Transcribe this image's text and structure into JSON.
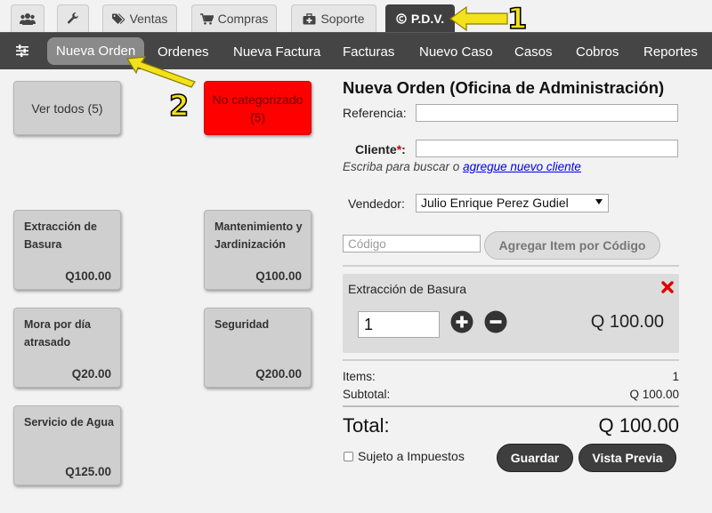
{
  "top_tabs": [
    {
      "label": "",
      "icon": "users-icon"
    },
    {
      "label": "",
      "icon": "wrench-icon"
    },
    {
      "label": "Ventas",
      "icon": "tags-icon"
    },
    {
      "label": "Compras",
      "icon": "cart-icon"
    },
    {
      "label": "Soporte",
      "icon": "medkit-icon"
    },
    {
      "label": "P.D.V.",
      "icon": "circle-c-icon",
      "active": true
    }
  ],
  "nav": {
    "items": [
      "Nueva Orden",
      "Ordenes",
      "Nueva Factura",
      "Facturas",
      "Nuevo Caso",
      "Casos",
      "Cobros",
      "Reportes"
    ],
    "active": "Nueva Orden"
  },
  "annotations": [
    "1",
    "2"
  ],
  "categories": [
    {
      "label": "Ver todos (5)",
      "color": "#cfcfcf"
    },
    {
      "label": "No categorizado (5)",
      "color": "#ff0000"
    }
  ],
  "products": [
    {
      "name": "Extracción de Basura",
      "price": "Q100.00"
    },
    {
      "name": "Mantenimiento y Jardinización",
      "price": "Q100.00"
    },
    {
      "name": "Mora por día atrasado",
      "price": "Q20.00"
    },
    {
      "name": "Seguridad",
      "price": "Q200.00"
    },
    {
      "name": "Servicio de Agua",
      "price": "Q125.00"
    }
  ],
  "order": {
    "title": "Nueva Orden (Oficina de Administración)",
    "referencia_label": "Referencia:",
    "referencia_value": "",
    "cliente_label": "Cliente",
    "cliente_value": "",
    "hint_text": "Escriba para buscar o ",
    "hint_link": "agregue nuevo cliente",
    "vendedor_label": "Vendedor:",
    "vendedor_value": "Julio Enrique Perez Gudiel",
    "codigo_placeholder": "Código",
    "add_by_code_label": "Agregar Item por Código",
    "line_item": {
      "name": "Extracción de Basura",
      "quantity": "1",
      "price": "Q 100.00"
    },
    "items_label": "Items:",
    "items_count": "1",
    "subtotal_label": "Subtotal:",
    "subtotal_value": "Q 100.00",
    "total_label": "Total:",
    "total_value": "Q 100.00",
    "tax_label": "Sujeto a Impuestos",
    "tax_checked": false,
    "save_label": "Guardar",
    "preview_label": "Vista Previa"
  },
  "colors": {
    "navbar": "#454545",
    "annotation": "#f3e21a",
    "category_red": "#ff0000",
    "delete": "#e00000"
  }
}
